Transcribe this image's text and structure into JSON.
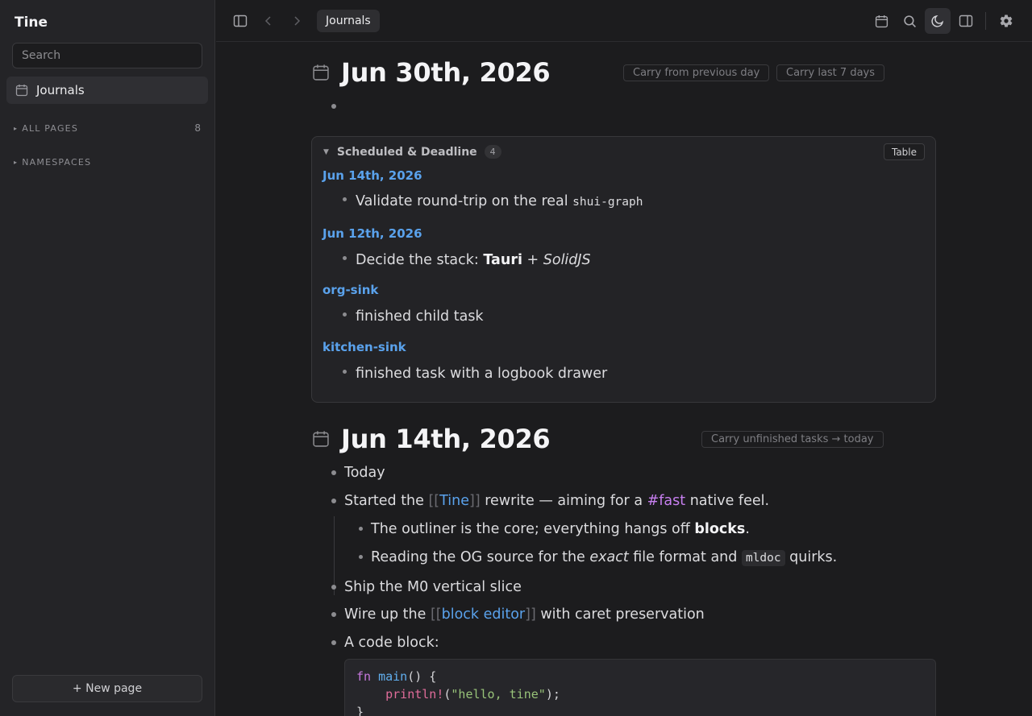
{
  "sidebar": {
    "app_title": "Tine",
    "search_placeholder": "Search",
    "journals_label": "Journals",
    "all_pages_label": "ALL PAGES",
    "all_pages_count": "8",
    "namespaces_label": "NAMESPACES",
    "new_page_label": "+ New page"
  },
  "topbar": {
    "breadcrumb": "Journals",
    "icons": [
      "sidebar-toggle-icon",
      "back-icon",
      "forward-icon",
      "calendar-icon",
      "search-icon",
      "moon-icon",
      "right-panel-icon",
      "gear-icon"
    ]
  },
  "journal1": {
    "title": "Jun 30th, 2026",
    "carry_prev": "Carry from previous day",
    "carry_week": "Carry last 7 days"
  },
  "scheduled": {
    "title": "Scheduled & Deadline",
    "count": "4",
    "table_label": "Table",
    "groups": [
      {
        "title": "Jun 14th, 2026",
        "item_text": "Validate round-trip on the real ",
        "item_code": "shui-graph"
      },
      {
        "title": "Jun 12th, 2026",
        "item_prefix": "Decide the stack: ",
        "item_bold": "Tauri",
        "item_mid": " + ",
        "item_italic": "SolidJS"
      },
      {
        "title": "org-sink",
        "item_text": "finished child task"
      },
      {
        "title": "kitchen-sink",
        "item_text": "finished task with a logbook drawer"
      }
    ]
  },
  "journal2": {
    "title": "Jun 14th, 2026",
    "carry_today": "Carry unfinished tasks → today",
    "b1": "Today",
    "b2": {
      "pre": "Started the ",
      "lb": "[[",
      "link": "Tine",
      "rb": "]]",
      "mid": " rewrite — aiming for a ",
      "tag": "#fast",
      "post": " native feel."
    },
    "b2a": {
      "pre": "The outliner is the core; everything hangs off ",
      "bold": "blocks",
      "post": "."
    },
    "b2b": {
      "pre": "Reading the OG source for the ",
      "italic": "exact",
      "mid": " file format and ",
      "code": "mldoc",
      "post": " quirks."
    },
    "b3": "Ship the M0 vertical slice",
    "b4": {
      "pre": "Wire up the ",
      "lb": "[[",
      "link": "block editor",
      "rb": "]]",
      "post": " with caret preservation"
    },
    "b5": "A code block:",
    "code": {
      "l1_kw": "fn",
      "l1_fn": "main",
      "l1_rest": "() {",
      "l2_indent": "    ",
      "l2_mac": "println!",
      "l2_open": "(",
      "l2_str": "\"hello, tine\"",
      "l2_close": ");",
      "l3": "}"
    }
  }
}
